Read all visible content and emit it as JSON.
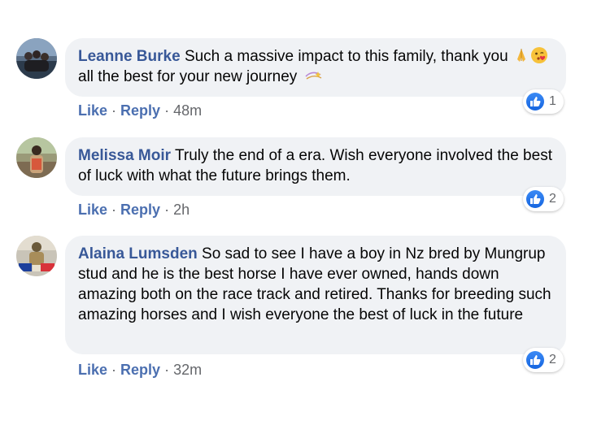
{
  "comments": [
    {
      "author": "Leanne Burke",
      "text_parts": [
        "Such a massive impact to this family, thank you ",
        " all the best for your new journey "
      ],
      "emojis": [
        "folded-hands",
        "face-blowing-kiss",
        "dizzy"
      ],
      "actions": {
        "like": "Like",
        "reply": "Reply",
        "time": "48m"
      },
      "reactions": {
        "type": "like",
        "count": "1"
      }
    },
    {
      "author": "Melissa Moir",
      "text": "Truly the end of a era. Wish everyone involved the best of luck with what the future brings them.",
      "actions": {
        "like": "Like",
        "reply": "Reply",
        "time": "2h"
      },
      "reactions": {
        "type": "like",
        "count": "2"
      }
    },
    {
      "author": "Alaina Lumsden",
      "text": "So sad to see I have a boy in Nz bred by Mungrup stud and he is the best horse I have ever owned, hands down amazing both on the race track and retired. Thanks for breeding such amazing horses and I wish everyone the best of luck in the future",
      "actions": {
        "like": "Like",
        "reply": "Reply",
        "time": "32m"
      },
      "reactions": {
        "type": "like",
        "count": "2"
      }
    }
  ],
  "separator": "·",
  "colors": {
    "author": "#385898",
    "bubble": "#f0f2f5",
    "link": "#4b6fb0",
    "like_badge": "#1877f2"
  }
}
